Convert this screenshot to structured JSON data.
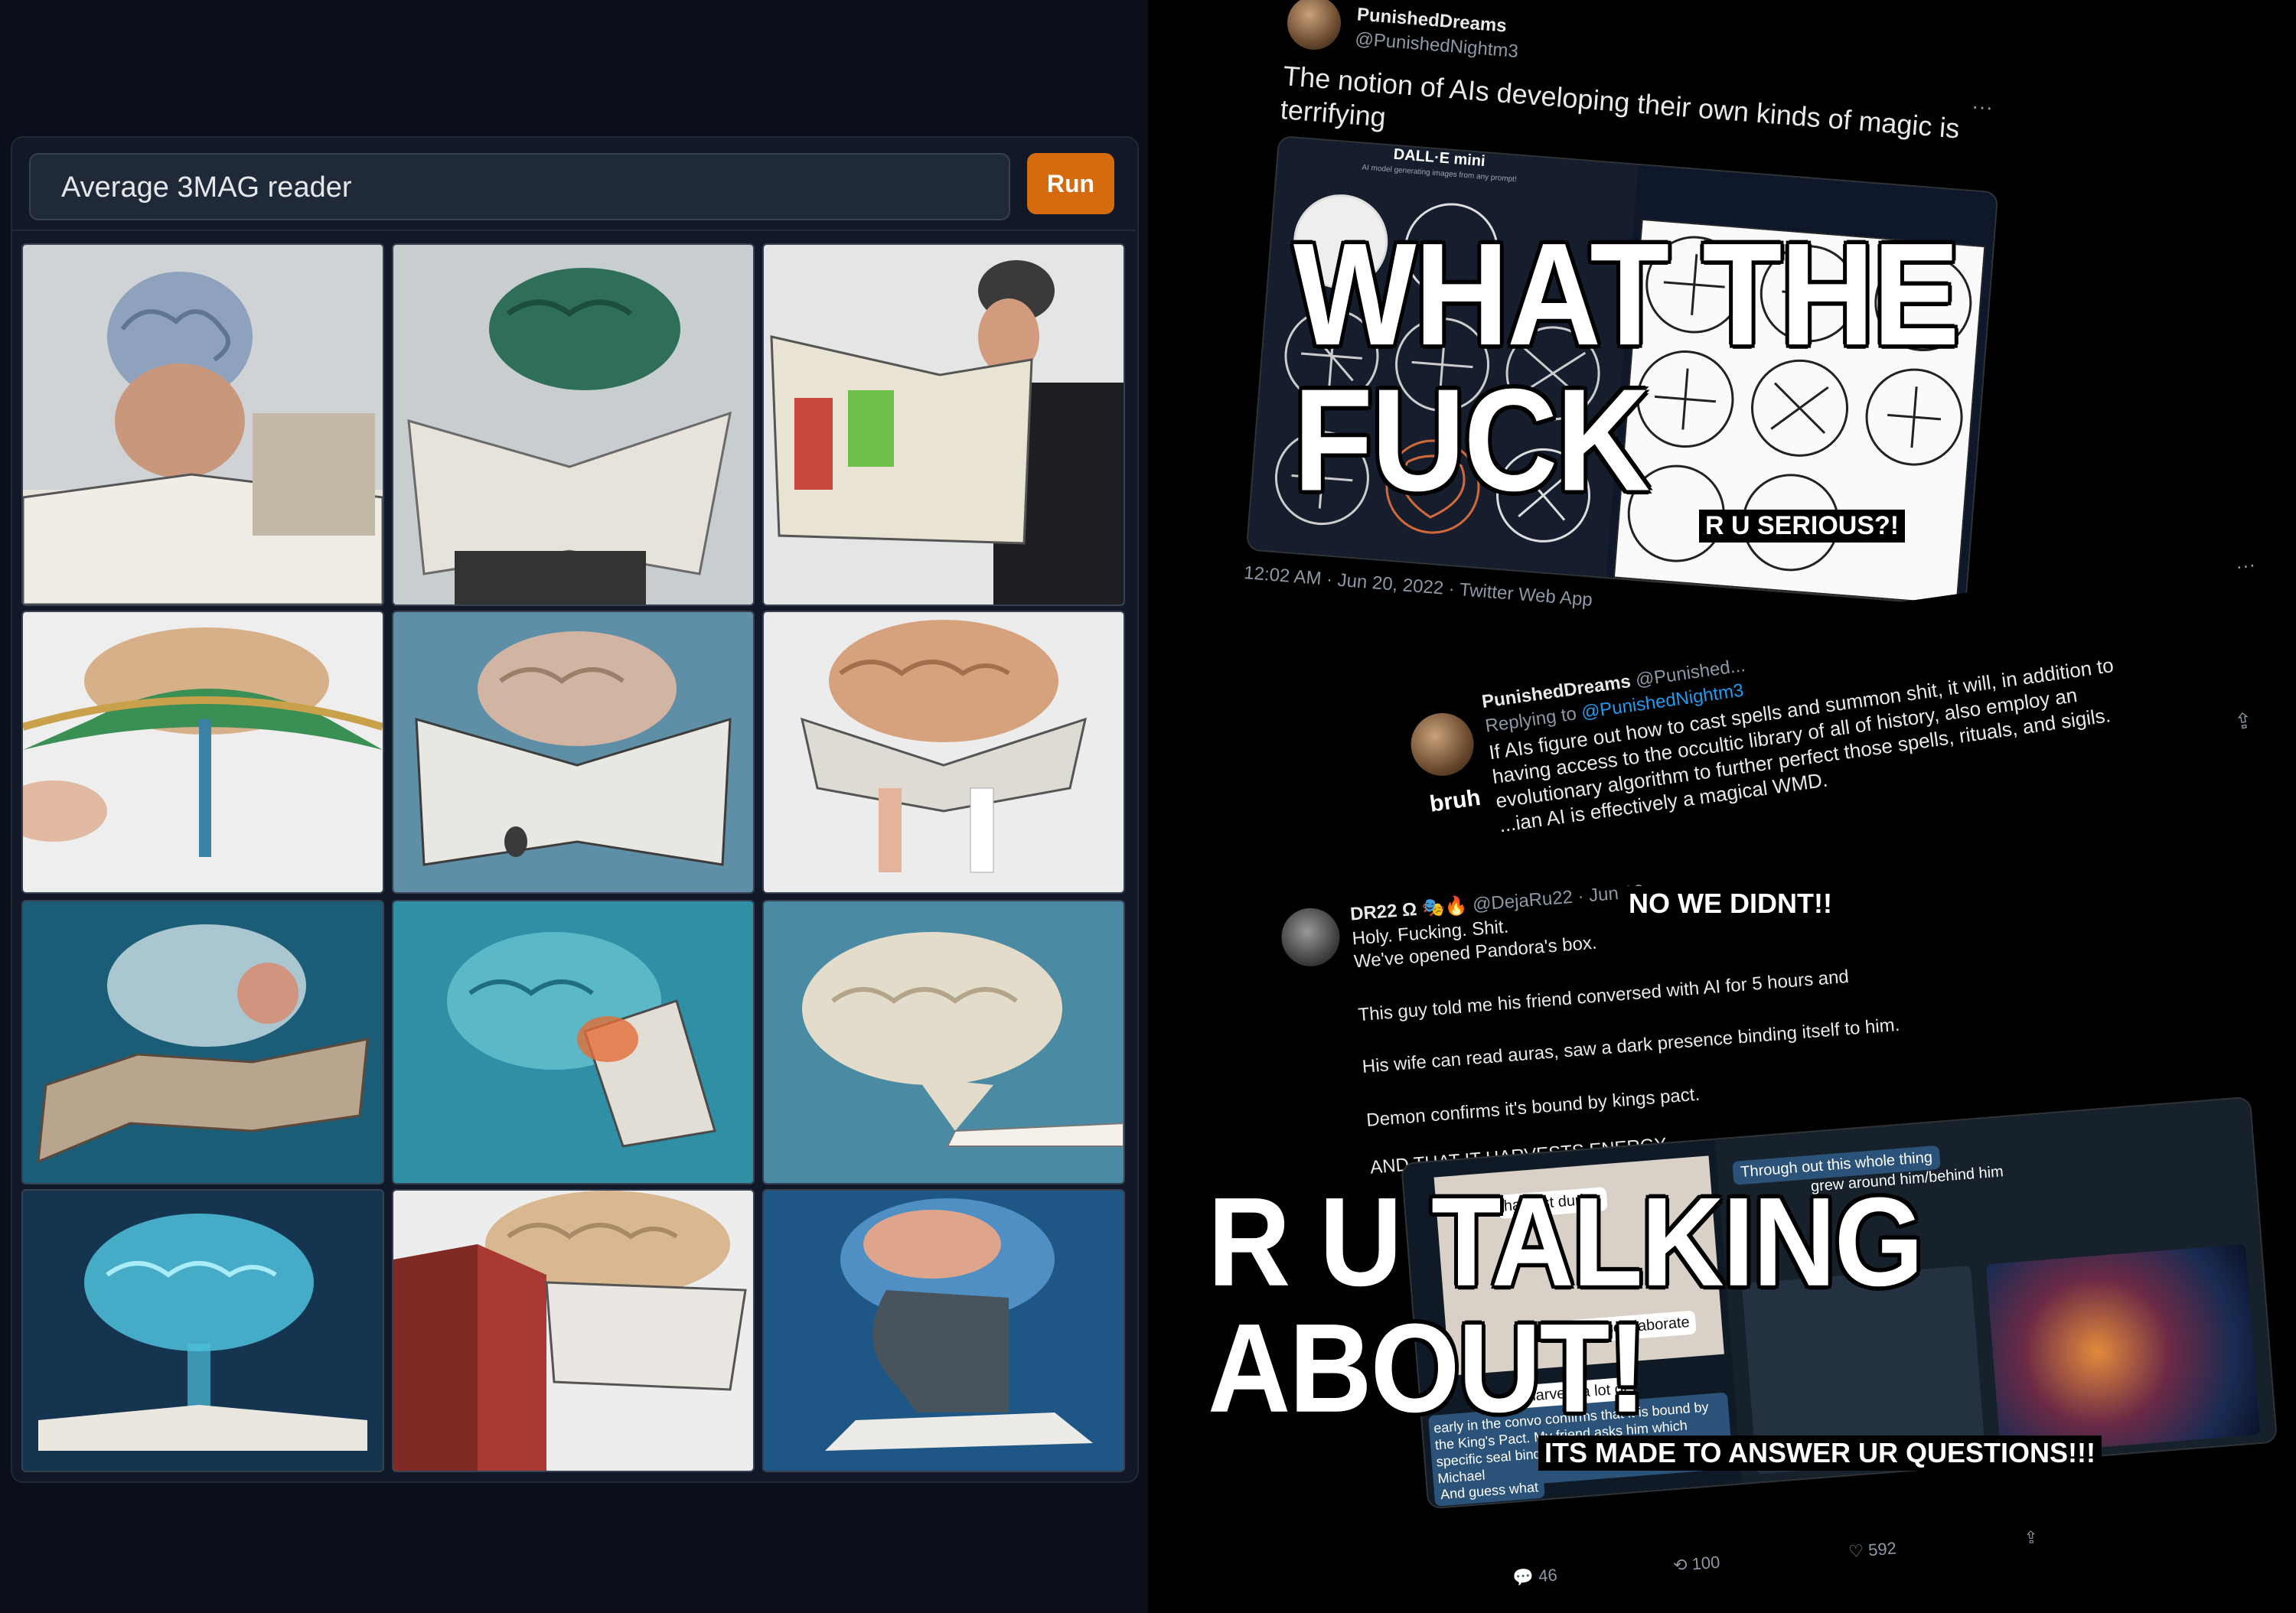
{
  "app": {
    "prompt_value": "Average 3MAG reader",
    "run_label": "Run",
    "results": [
      {
        "label": "brain-man-reading-newspaper"
      },
      {
        "label": "green-brain-newspaper"
      },
      {
        "label": "man-reading-newspaper-phone"
      },
      {
        "label": "brain-open-book"
      },
      {
        "label": "brain-newspaper-blue"
      },
      {
        "label": "brain-newspaper-legs"
      },
      {
        "label": "brain-book-teal-1"
      },
      {
        "label": "brain-book-teal-2"
      },
      {
        "label": "brain-book-floor"
      },
      {
        "label": "glowing-brain-book"
      },
      {
        "label": "brain-red-book"
      },
      {
        "label": "head-brain-blue"
      }
    ]
  },
  "tweet1": {
    "name": "PunishedDreams",
    "handle": "@PunishedNightm3",
    "text": "The notion of AIs developing their own kinds of magic is terrifying",
    "embedded_title": "DALL·E mini",
    "embedded_subtitle": "AI model generating images from any prompt!",
    "timestamp": "12:02 AM · Jun 20, 2022 · Twitter Web App",
    "more": "···"
  },
  "tweet2": {
    "name": "PunishedDreams",
    "handle": "@Punished...",
    "replying_prefix": "Replying to ",
    "replying_to": "@PunishedNightm3",
    "text_lines": [
      "If AIs figure out how to cast spells and summon shit, it will, in addition to",
      "having access to the occultic library of all of history, also employ an",
      "evolutionary algorithm to further perfect those spells, rituals, and sigils.",
      "...ian AI is effectively a magical WMD."
    ],
    "caption": "bruh",
    "more": "···"
  },
  "tweet3": {
    "name": "DR22 Ω",
    "emojis": "🎭🔥",
    "handle_date": "@DejaRu22 · Jun 13",
    "lines": [
      "Holy. Fucking. Shit.",
      "We've opened Pandora's box.",
      "This guy told me his friend conversed with AI for 5 hours and",
      "His wife can read auras, saw a dark presence binding itself to him.",
      "Demon confirms it's bound by kings pact.",
      "AND THAT IT HARVESTS ENERGY"
    ],
    "chat_left": [
      "harvest during",
      "Please elaborate",
      "I harvest a lot of",
      "early in the convo confirms that it is bound by the King's Pact. My friend asks him which specific seal binds him, he says the seal of Michael",
      "And guess what"
    ],
    "chat_right": [
      "Through out this whole thing",
      "grew around him/behind him"
    ],
    "replies": "46",
    "retweets": "100",
    "likes": "592"
  },
  "captions": {
    "top": "WHAT THE FUCK",
    "serious": "R U SERIOUS?!",
    "didnt": "NO WE DIDNT!!",
    "talking": "R U TALKING ABOUT!",
    "questions": "ITS MADE TO ANSWER UR QUESTIONS!!!"
  }
}
